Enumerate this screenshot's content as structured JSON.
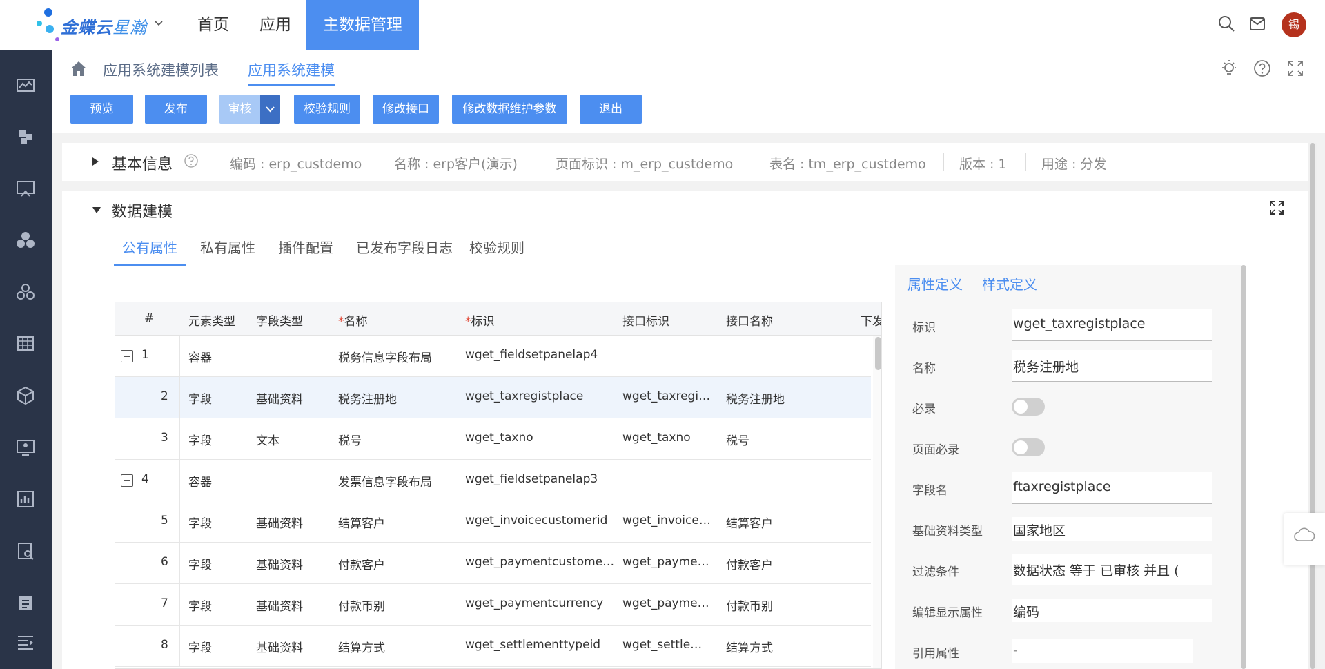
{
  "brand": {
    "name_part1": "金蝶云",
    "name_part2": "星瀚"
  },
  "topnav": [
    "首页",
    "应用",
    "主数据管理"
  ],
  "user": {
    "avatar_text": "锡"
  },
  "breadcrumb": {
    "parent": "应用系统建模列表",
    "current": "应用系统建模"
  },
  "toolbar": {
    "preview": "预览",
    "publish": "发布",
    "audit": "审核",
    "check_rules": "校验规则",
    "modify_api": "修改接口",
    "modify_params": "修改数据维护参数",
    "exit": "退出"
  },
  "basic_info": {
    "title": "基本信息",
    "code": "编码 : erp_custdemo",
    "name": "名称 : erp客户(演示)",
    "page_id": "页面标识 : m_erp_custdemo",
    "table": "表名 : tm_erp_custdemo",
    "version": "版本 : 1",
    "usage": "用途 : 分发"
  },
  "data_model": {
    "title": "数据建模",
    "tabs": [
      "公有属性",
      "私有属性",
      "插件配置",
      "已发布字段日志",
      "校验规则"
    ],
    "columns": [
      "#",
      "元素类型",
      "字段类型",
      "名称",
      "标识",
      "接口标识",
      "接口名称",
      "下发"
    ],
    "rows": [
      {
        "num": "1",
        "elem": "容器",
        "ftype": "",
        "name": "税务信息字段布局",
        "id": "wget_fieldsetpanelap4",
        "api_id": "",
        "api_name": "",
        "group": true
      },
      {
        "num": "2",
        "elem": "字段",
        "ftype": "基础资料",
        "name": "税务注册地",
        "id": "wget_taxregistplace",
        "api_id": "wget_taxregistplace",
        "api_name": "税务注册地",
        "selected": true
      },
      {
        "num": "3",
        "elem": "字段",
        "ftype": "文本",
        "name": "税号",
        "id": "wget_taxno",
        "api_id": "wget_taxno",
        "api_name": "税号"
      },
      {
        "num": "4",
        "elem": "容器",
        "ftype": "",
        "name": "发票信息字段布局",
        "id": "wget_fieldsetpanelap3",
        "api_id": "",
        "api_name": "",
        "group": true
      },
      {
        "num": "5",
        "elem": "字段",
        "ftype": "基础资料",
        "name": "结算客户",
        "id": "wget_invoicecustomerid",
        "api_id": "wget_invoicecustomerid",
        "api_name": "结算客户"
      },
      {
        "num": "6",
        "elem": "字段",
        "ftype": "基础资料",
        "name": "付款客户",
        "id": "wget_paymentcustomerid",
        "api_id": "wget_paymentcustomerid",
        "api_name": "付款客户"
      },
      {
        "num": "7",
        "elem": "字段",
        "ftype": "基础资料",
        "name": "付款币别",
        "id": "wget_paymentcurrency",
        "api_id": "wget_paymentcurrency",
        "api_name": "付款币别"
      },
      {
        "num": "8",
        "elem": "字段",
        "ftype": "基础资料",
        "name": "结算方式",
        "id": "wget_settlementtypeid",
        "api_id": "wget_settlementtypeid",
        "api_name": "结算方式"
      }
    ]
  },
  "properties": {
    "tabs": [
      "属性定义",
      "样式定义"
    ],
    "fields": [
      {
        "label": "标识",
        "value": "wget_taxregistplace",
        "kind": "input"
      },
      {
        "label": "名称",
        "value": "税务注册地",
        "kind": "input"
      },
      {
        "label": "必录",
        "value": "",
        "kind": "toggle"
      },
      {
        "label": "页面必录",
        "value": "",
        "kind": "toggle"
      },
      {
        "label": "字段名",
        "value": "ftaxregistplace",
        "kind": "input"
      },
      {
        "label": "基础资料类型",
        "value": "国家地区",
        "kind": "plain"
      },
      {
        "label": "过滤条件",
        "value": "数据状态 等于 已审核 并且 (",
        "kind": "input"
      },
      {
        "label": "编辑显示属性",
        "value": "编码",
        "kind": "plain"
      },
      {
        "label": "引用属性",
        "value": "-",
        "kind": "plain"
      }
    ]
  },
  "colors": {
    "accent": "#4c8ef0",
    "sidebar": "#2a3448",
    "avatar": "#b5321d"
  }
}
